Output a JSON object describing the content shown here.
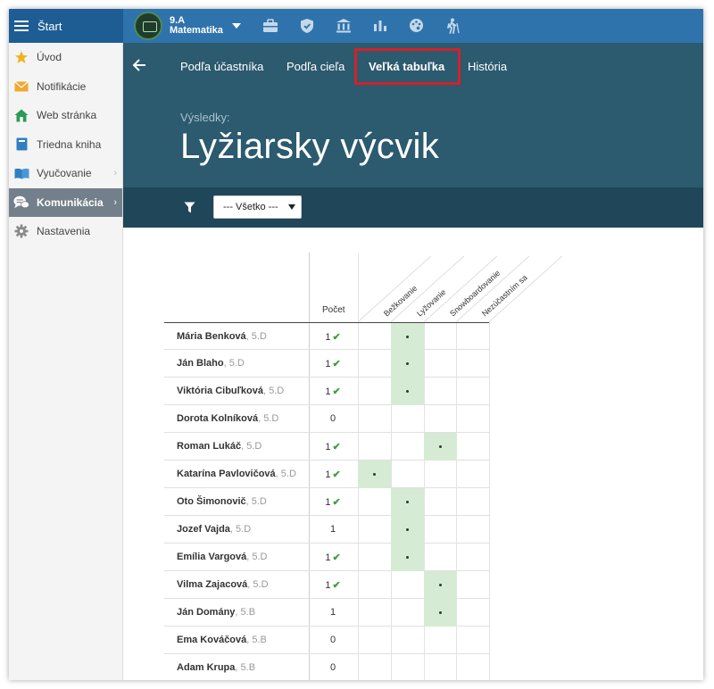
{
  "topbar": {
    "menu_label": "Štart",
    "class_name": "9.A",
    "subject": "Matematika",
    "icons": [
      "briefcase-icon",
      "shield-icon",
      "bank-icon",
      "bar-chart-icon",
      "palette-icon",
      "hiking-icon"
    ]
  },
  "sidebar": {
    "items": [
      {
        "label": "Úvod",
        "icon": "star-icon",
        "color": "#f2b21b"
      },
      {
        "label": "Notifikácie",
        "icon": "envelope-icon",
        "color": "#f0a830"
      },
      {
        "label": "Web stránka",
        "icon": "home-icon",
        "color": "#2e9a55"
      },
      {
        "label": "Triedna kniha",
        "icon": "book-icon",
        "color": "#2f7fc1"
      },
      {
        "label": "Vyučovanie",
        "icon": "open-book-icon",
        "color": "#2f7fc1"
      },
      {
        "label": "Komunikácia",
        "icon": "chat-icon",
        "color": "#ffffff",
        "active": true
      },
      {
        "label": "Nastavenia",
        "icon": "gear-icon",
        "color": "#8a8a8a"
      }
    ]
  },
  "tabs": [
    {
      "label": "Podľa účastníka"
    },
    {
      "label": "Podľa cieľa"
    },
    {
      "label": "Veľká tabuľka",
      "active": true
    },
    {
      "label": "História"
    }
  ],
  "header": {
    "results_label": "Výsledky:",
    "title": "Lyžiarsky výcvik"
  },
  "filter": {
    "selected": "--- Všetko ---"
  },
  "table": {
    "count_header": "Počet",
    "columns": [
      "Bežkovanie",
      "Lyžovanie",
      "Snowboardovanie",
      "Nezúčastním sa"
    ],
    "rows": [
      {
        "name": "Mária Benková",
        "class": ", 5.D",
        "count": "1",
        "check": true,
        "marks": [
          1
        ]
      },
      {
        "name": "Ján Blaho",
        "class": ", 5.D",
        "count": "1",
        "check": true,
        "marks": [
          1
        ]
      },
      {
        "name": "Viktória Cibuľková",
        "class": ", 5.D",
        "count": "1",
        "check": true,
        "marks": [
          1
        ]
      },
      {
        "name": "Dorota Kolníková",
        "class": ", 5.D",
        "count": "0",
        "check": false,
        "marks": []
      },
      {
        "name": "Roman Lukáč",
        "class": ", 5.D",
        "count": "1",
        "check": true,
        "marks": [
          2
        ]
      },
      {
        "name": "Katarína Pavlovičová",
        "class": ", 5.D",
        "count": "1",
        "check": true,
        "marks": [
          0
        ]
      },
      {
        "name": "Oto Šimonovič",
        "class": ", 5.D",
        "count": "1",
        "check": true,
        "marks": [
          1
        ]
      },
      {
        "name": "Jozef Vajda",
        "class": ", 5.D",
        "count": "1",
        "check": false,
        "marks": [
          1
        ]
      },
      {
        "name": "Emília Vargová",
        "class": ", 5.D",
        "count": "1",
        "check": true,
        "marks": [
          1
        ]
      },
      {
        "name": "Vilma Zajacová",
        "class": ", 5.D",
        "count": "1",
        "check": true,
        "marks": [
          2
        ]
      },
      {
        "name": "Ján Domány",
        "class": ", 5.B",
        "count": "1",
        "check": false,
        "marks": [
          2
        ]
      },
      {
        "name": "Ema Kováčová",
        "class": ", 5.B",
        "count": "0",
        "check": false,
        "marks": []
      },
      {
        "name": "Adam Krupa",
        "class": ", 5.B",
        "count": "0",
        "check": false,
        "marks": []
      }
    ]
  }
}
